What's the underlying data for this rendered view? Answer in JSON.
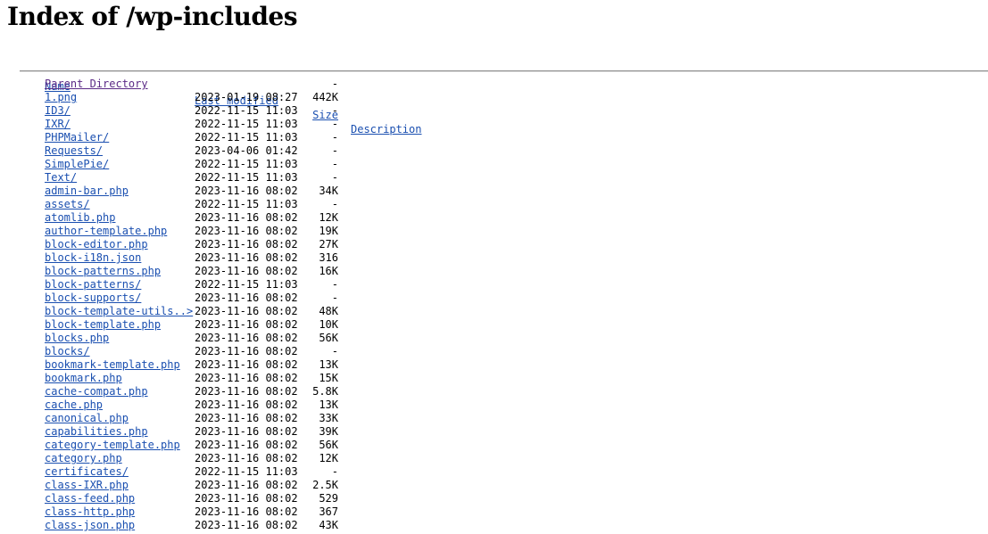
{
  "page": {
    "title": "Index of /wp-includes"
  },
  "columns": {
    "name": "Name",
    "last_modified": "Last modified",
    "size": "Size",
    "description": "Description"
  },
  "entries": [
    {
      "name": "Parent Directory",
      "modified": "",
      "size": "-",
      "icon": "back-icon"
    },
    {
      "name": "1.png",
      "modified": "2023-01-19 08:27",
      "size": "442K",
      "icon": "image-icon"
    },
    {
      "name": "ID3/",
      "modified": "2022-11-15 11:03",
      "size": "-",
      "icon": "folder-icon"
    },
    {
      "name": "IXR/",
      "modified": "2022-11-15 11:03",
      "size": "-",
      "icon": "folder-icon"
    },
    {
      "name": "PHPMailer/",
      "modified": "2022-11-15 11:03",
      "size": "-",
      "icon": "folder-icon"
    },
    {
      "name": "Requests/",
      "modified": "2023-04-06 01:42",
      "size": "-",
      "icon": "folder-icon"
    },
    {
      "name": "SimplePie/",
      "modified": "2022-11-15 11:03",
      "size": "-",
      "icon": "folder-icon"
    },
    {
      "name": "Text/",
      "modified": "2022-11-15 11:03",
      "size": "-",
      "icon": "folder-icon"
    },
    {
      "name": "admin-bar.php",
      "modified": "2023-11-16 08:02",
      "size": "34K",
      "icon": "file-icon"
    },
    {
      "name": "assets/",
      "modified": "2022-11-15 11:03",
      "size": "-",
      "icon": "folder-icon"
    },
    {
      "name": "atomlib.php",
      "modified": "2023-11-16 08:02",
      "size": "12K",
      "icon": "file-icon"
    },
    {
      "name": "author-template.php",
      "modified": "2023-11-16 08:02",
      "size": "19K",
      "icon": "file-icon"
    },
    {
      "name": "block-editor.php",
      "modified": "2023-11-16 08:02",
      "size": "27K",
      "icon": "file-icon"
    },
    {
      "name": "block-i18n.json",
      "modified": "2023-11-16 08:02",
      "size": "316",
      "icon": "file-icon"
    },
    {
      "name": "block-patterns.php",
      "modified": "2023-11-16 08:02",
      "size": "16K",
      "icon": "file-icon"
    },
    {
      "name": "block-patterns/",
      "modified": "2022-11-15 11:03",
      "size": "-",
      "icon": "folder-icon"
    },
    {
      "name": "block-supports/",
      "modified": "2023-11-16 08:02",
      "size": "-",
      "icon": "folder-icon"
    },
    {
      "name": "block-template-utils..>",
      "modified": "2023-11-16 08:02",
      "size": "48K",
      "icon": "file-icon"
    },
    {
      "name": "block-template.php",
      "modified": "2023-11-16 08:02",
      "size": "10K",
      "icon": "file-icon"
    },
    {
      "name": "blocks.php",
      "modified": "2023-11-16 08:02",
      "size": "56K",
      "icon": "file-icon"
    },
    {
      "name": "blocks/",
      "modified": "2023-11-16 08:02",
      "size": "-",
      "icon": "folder-icon"
    },
    {
      "name": "bookmark-template.php",
      "modified": "2023-11-16 08:02",
      "size": "13K",
      "icon": "file-icon"
    },
    {
      "name": "bookmark.php",
      "modified": "2023-11-16 08:02",
      "size": "15K",
      "icon": "file-icon"
    },
    {
      "name": "cache-compat.php",
      "modified": "2023-11-16 08:02",
      "size": "5.8K",
      "icon": "file-icon"
    },
    {
      "name": "cache.php",
      "modified": "2023-11-16 08:02",
      "size": "13K",
      "icon": "file-icon"
    },
    {
      "name": "canonical.php",
      "modified": "2023-11-16 08:02",
      "size": "33K",
      "icon": "file-icon"
    },
    {
      "name": "capabilities.php",
      "modified": "2023-11-16 08:02",
      "size": "39K",
      "icon": "file-icon"
    },
    {
      "name": "category-template.php",
      "modified": "2023-11-16 08:02",
      "size": "56K",
      "icon": "file-icon"
    },
    {
      "name": "category.php",
      "modified": "2023-11-16 08:02",
      "size": "12K",
      "icon": "file-icon"
    },
    {
      "name": "certificates/",
      "modified": "2022-11-15 11:03",
      "size": "-",
      "icon": "folder-icon"
    },
    {
      "name": "class-IXR.php",
      "modified": "2023-11-16 08:02",
      "size": "2.5K",
      "icon": "file-icon"
    },
    {
      "name": "class-feed.php",
      "modified": "2023-11-16 08:02",
      "size": "529",
      "icon": "file-icon"
    },
    {
      "name": "class-http.php",
      "modified": "2023-11-16 08:02",
      "size": "367",
      "icon": "file-icon"
    },
    {
      "name": "class-json.php",
      "modified": "2023-11-16 08:02",
      "size": "43K",
      "icon": "file-icon"
    }
  ],
  "colors": {
    "link": "#1a4fb0",
    "visited_link": "#5b2a86",
    "rule": "#8a8a8a"
  }
}
